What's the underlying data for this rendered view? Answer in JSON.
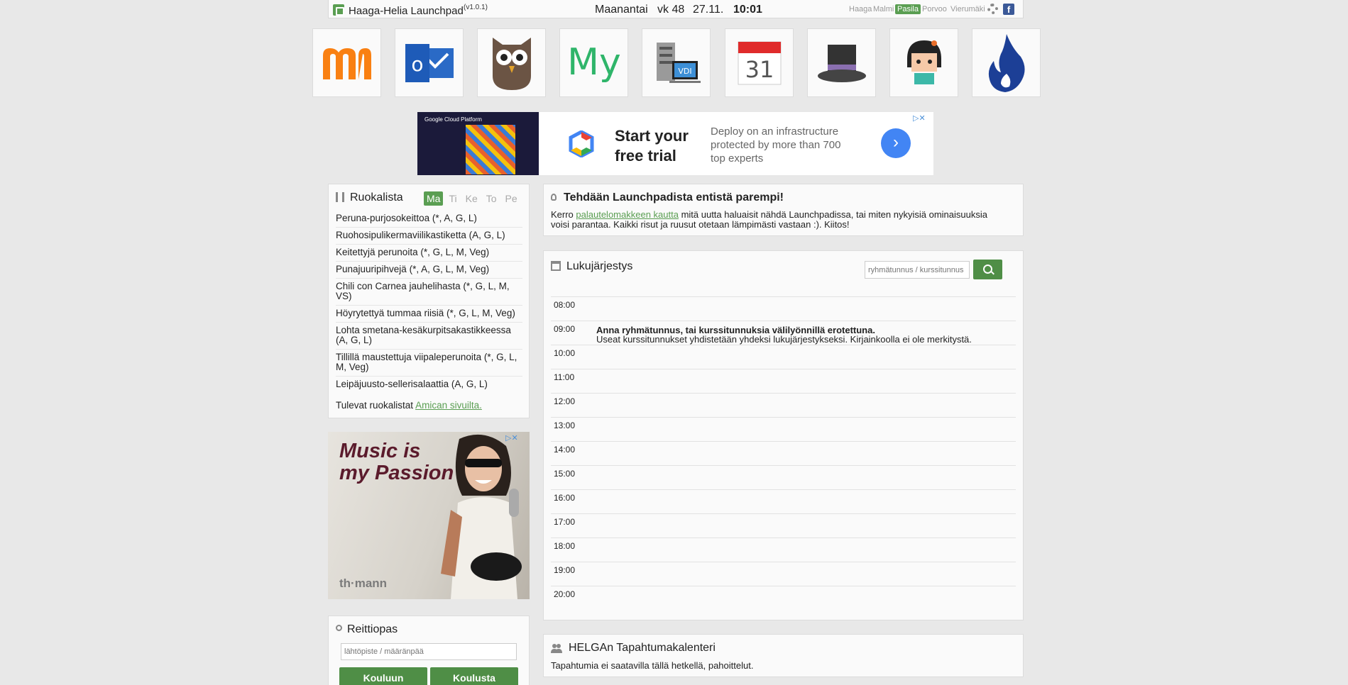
{
  "header": {
    "app_title": "Haaga-Helia Launchpad",
    "version": "(v1.0.1)",
    "weekday": "Maanantai",
    "week": "vk 48",
    "date": "27.11.",
    "time": "10:01",
    "campuses": [
      "Haaga",
      "Malmi",
      "Pasila",
      "Porvoo",
      "Vierumäki"
    ],
    "active_campus": "Pasila"
  },
  "tiles": [
    {
      "name": "moodle",
      "icon": "moodle-icon"
    },
    {
      "name": "outlook",
      "icon": "outlook-icon"
    },
    {
      "name": "owl",
      "icon": "owl-icon"
    },
    {
      "name": "my",
      "icon": "my-icon"
    },
    {
      "name": "vdi",
      "icon": "vdi-icon",
      "label": "VDI"
    },
    {
      "name": "calendar",
      "icon": "calendar-icon",
      "label": "31"
    },
    {
      "name": "tophat",
      "icon": "tophat-icon"
    },
    {
      "name": "character",
      "icon": "character-icon"
    },
    {
      "name": "flame",
      "icon": "flame-icon"
    }
  ],
  "ad_top": {
    "brand": "Google Cloud Platform",
    "headline": "Start your free trial",
    "body": "Deploy on an infrastructure protected by more than 700 top experts"
  },
  "ruokalista": {
    "title": "Ruokalista",
    "days": [
      "Ma",
      "Ti",
      "Ke",
      "To",
      "Pe"
    ],
    "active_day": "Ma",
    "items": [
      "Peruna-purjosokeittoa (*, A, G, L)",
      "Ruohosipulikermaviilikastiketta (A, G, L)",
      "Keitettyjä perunoita (*, G, L, M, Veg)",
      "Punajuuripihvejä (*, A, G, L, M, Veg)",
      "Chili con Carnea jauhelihasta (*, G, L, M, VS)",
      "Höyrytettyä tummaa riisiä (*, G, L, M, Veg)",
      "Lohta smetana-kesäkurpitsakastikkeessa (A, G, L)",
      "Tillillä maustettuja viipaleperunoita (*, G, L, M, Veg)",
      "Leipäjuusto-sellerisalaattia (A, G, L)"
    ],
    "footer_text": "Tulevat ruokalistat",
    "footer_link": "Amican sivuilta."
  },
  "ad_side": {
    "slogan_line1": "Music is",
    "slogan_line2": "my Passion",
    "brand": "th·mann"
  },
  "reittiopas": {
    "title": "Reittiopas",
    "placeholder": "lähtöpiste / määränpää",
    "to_school": "Kouluun",
    "from_school": "Koulusta"
  },
  "feedback": {
    "title": "Tehdään Launchpadista entistä parempi!",
    "text_before": "Kerro ",
    "link": "palautelomakkeen kautta",
    "text_after": " mitä uutta haluaisit nähdä Launchpadissa, tai miten nykyisiä ominaisuuksia voisi parantaa. Kaikki risut ja ruusut otetaan lämpimästi vastaan :). Kiitos!"
  },
  "lukujarjestys": {
    "title": "Lukujärjestys",
    "search_placeholder": "ryhmätunnus / kurssitunnus",
    "hours": [
      "08:00",
      "09:00",
      "10:00",
      "11:00",
      "12:00",
      "13:00",
      "14:00",
      "15:00",
      "16:00",
      "17:00",
      "18:00",
      "19:00",
      "20:00"
    ],
    "notice_title": "Anna ryhmätunnus, tai kurssitunnuksia välilyönnillä erotettuna.",
    "notice_text": "Useat kurssitunnukset yhdistetään yhdeksi lukujärjestykseksi. Kirjainkoolla ei ole merkitystä."
  },
  "helga": {
    "title": "HELGAn Tapahtumakalenteri",
    "text": "Tapahtumia ei saatavilla tällä hetkellä, pahoittelut."
  }
}
